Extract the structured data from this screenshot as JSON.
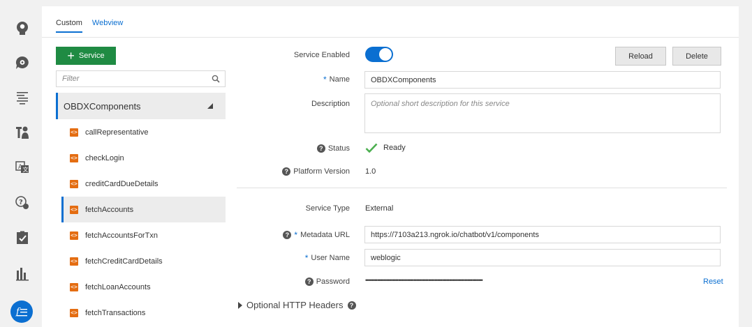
{
  "rail": {
    "items": [
      {
        "icon": "robot-head-icon"
      },
      {
        "icon": "chat-gear-icon"
      },
      {
        "icon": "list-icon"
      },
      {
        "icon": "tools-icon"
      },
      {
        "icon": "translate-icon"
      },
      {
        "icon": "question-search-icon"
      },
      {
        "icon": "checklist-icon"
      },
      {
        "icon": "bar-chart-icon"
      },
      {
        "icon": "function-icon"
      }
    ],
    "active_color": "#0b6fd1"
  },
  "tabs": [
    {
      "label": "Custom",
      "active": true
    },
    {
      "label": "Webview",
      "active": false
    }
  ],
  "sidebar": {
    "add_button_label": "Service",
    "filter_placeholder": "Filter",
    "service_name": "OBDXComponents",
    "components": [
      "callRepresentative",
      "checkLogin",
      "creditCardDueDetails",
      "fetchAccounts",
      "fetchAccountsForTxn",
      "fetchCreditCardDetails",
      "fetchLoanAccounts",
      "fetchTransactions"
    ],
    "selected_component": "fetchAccounts"
  },
  "form": {
    "service_enabled_label": "Service Enabled",
    "service_enabled": true,
    "reload_label": "Reload",
    "delete_label": "Delete",
    "name_label": "Name",
    "name_value": "OBDXComponents",
    "description_label": "Description",
    "description_placeholder": "Optional short description for this service",
    "status_label": "Status",
    "status_value": "Ready",
    "platform_version_label": "Platform Version",
    "platform_version_value": "1.0",
    "service_type_label": "Service Type",
    "service_type_value": "External",
    "metadata_url_label": "Metadata URL",
    "metadata_url_value": "https://7103a213.ngrok.io/chatbot/v1/components",
    "user_name_label": "User Name",
    "user_name_value": "weblogic",
    "password_label": "Password",
    "password_mask": "••••••••••••••••••••••••••••••••••••••••••••••••••••••••••••••••••••••••••••••",
    "reset_label": "Reset",
    "optional_headers_label": "Optional HTTP Headers"
  },
  "colors": {
    "accent": "#0b6fd1",
    "add_button": "#1f8b43",
    "component_icon": "#e46d12",
    "status_check": "#4caf50"
  }
}
